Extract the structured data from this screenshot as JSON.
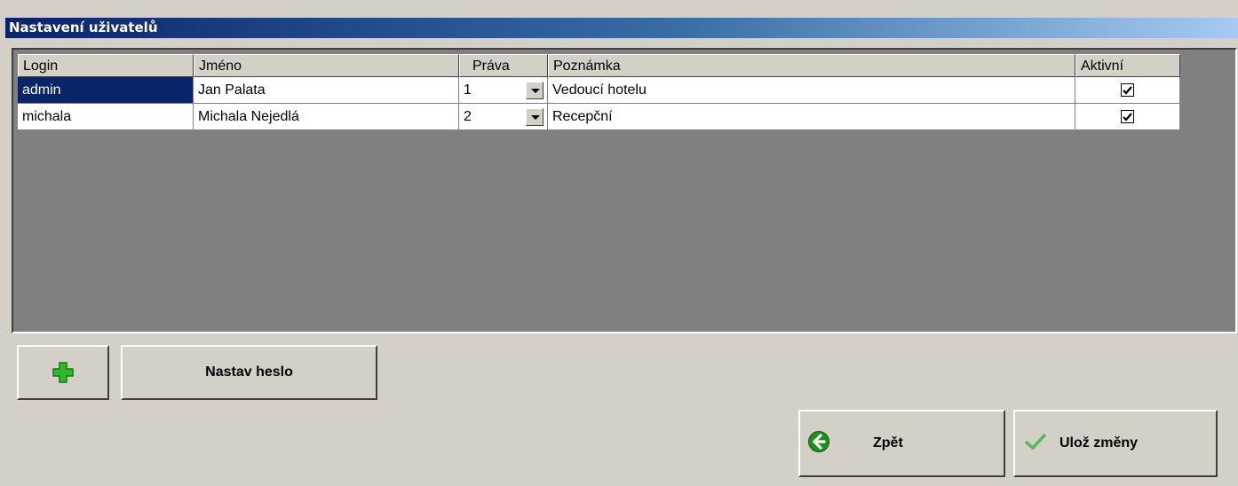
{
  "window": {
    "title": "Nastavení uživatelů"
  },
  "grid": {
    "columns": [
      "Login",
      "Jméno",
      "Práva",
      "Poznámka",
      "Aktivní"
    ],
    "rows": [
      {
        "login": "admin",
        "name": "Jan Palata",
        "prava": "1",
        "note": "Vedoucí hotelu",
        "active": true,
        "selected": true
      },
      {
        "login": "michala",
        "name": "Michala Nejedlá",
        "prava": "2",
        "note": "Recepční",
        "active": true,
        "selected": false
      }
    ]
  },
  "buttons": {
    "set_password": "Nastav heslo",
    "back": "Zpět",
    "save": "Ulož změny"
  },
  "icons": {
    "add": "plus-icon",
    "back": "back-arrow-icon",
    "save": "checkmark-icon"
  },
  "colors": {
    "selection": "#0a246a",
    "add_green": "#2eb82e",
    "back_green": "#1e8f1e"
  }
}
